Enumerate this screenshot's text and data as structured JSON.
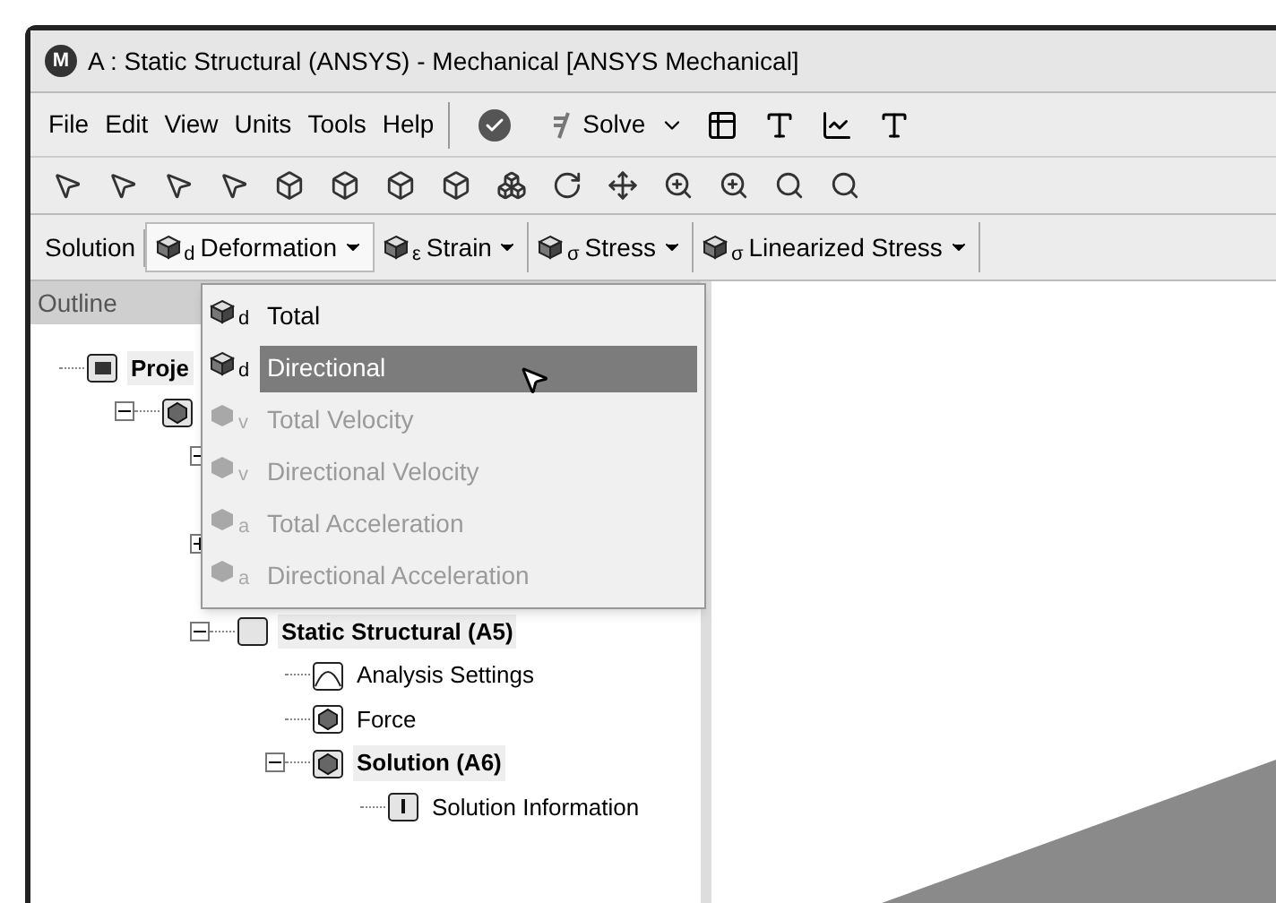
{
  "window": {
    "title": "A : Static Structural (ANSYS) - Mechanical [ANSYS Mechanical]",
    "logo": "M"
  },
  "menu_bar": [
    "File",
    "Edit",
    "View",
    "Units",
    "Tools",
    "Help"
  ],
  "solve_button": {
    "label": "Solve"
  },
  "context_toolbar": {
    "label": "Solution",
    "buttons": [
      {
        "label": "Deformation",
        "sub": "d",
        "open": true
      },
      {
        "label": "Strain",
        "sub": "ε",
        "open": false
      },
      {
        "label": "Stress",
        "sub": "σ",
        "open": false
      },
      {
        "label": "Linearized Stress",
        "sub": "σ",
        "open": false
      }
    ]
  },
  "outline": {
    "title": "Outline",
    "tree": [
      {
        "label": "Proje",
        "kind": "project",
        "bold": true,
        "children": [
          {
            "kind": "model",
            "expanded": true,
            "children": [
              {
                "kind": "hidden",
                "expanded": true,
                "children": [
                  {
                    "kind": "hidden"
                  }
                ]
              },
              {
                "kind": "hidden",
                "expanded": false
              },
              {
                "kind": "hidden"
              },
              {
                "label": "Static Structural (A5)",
                "kind": "analysis",
                "bold": true,
                "expanded": true,
                "children": [
                  {
                    "label": "Analysis Settings",
                    "kind": "settings",
                    "bold": false
                  },
                  {
                    "label": "Force",
                    "kind": "force",
                    "bold": false
                  },
                  {
                    "label": "Solution (A6)",
                    "kind": "solution",
                    "bold": true,
                    "expanded": true,
                    "children": [
                      {
                        "label": "Solution Information",
                        "kind": "info",
                        "bold": false
                      }
                    ]
                  }
                ]
              }
            ]
          }
        ]
      }
    ]
  },
  "deformation_menu": [
    {
      "label": "Total",
      "sub": "d",
      "disabled": false,
      "selected": false
    },
    {
      "label": "Directional",
      "sub": "d",
      "disabled": false,
      "selected": true
    },
    {
      "label": "Total Velocity",
      "sub": "v",
      "disabled": true,
      "selected": false
    },
    {
      "label": "Directional Velocity",
      "sub": "v",
      "disabled": true,
      "selected": false
    },
    {
      "label": "Total Acceleration",
      "sub": "a",
      "disabled": true,
      "selected": false
    },
    {
      "label": "Directional Acceleration",
      "sub": "a",
      "disabled": true,
      "selected": false
    }
  ]
}
